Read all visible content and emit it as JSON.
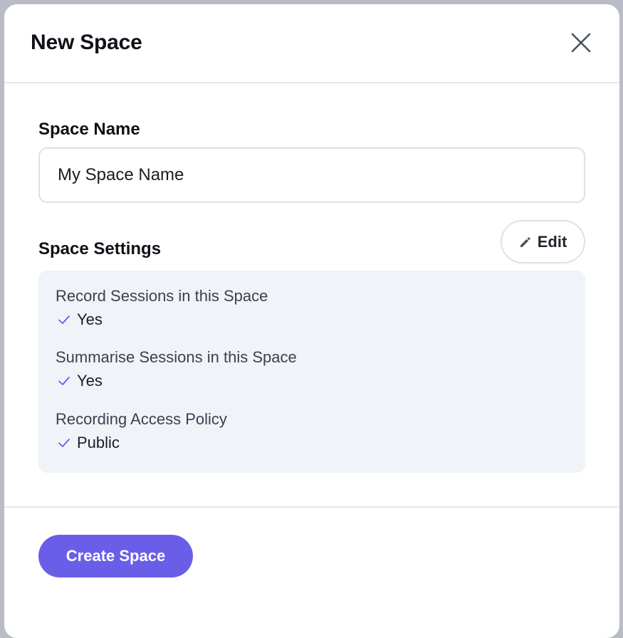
{
  "dialog": {
    "title": "New Space",
    "close_icon": "close-icon"
  },
  "space_name": {
    "label": "Space Name",
    "value": "My Space Name"
  },
  "space_settings": {
    "label": "Space Settings",
    "edit_label": "Edit",
    "edit_icon": "pencil-icon",
    "items": [
      {
        "title": "Record Sessions in this Space",
        "value": "Yes",
        "icon": "check-icon"
      },
      {
        "title": "Summarise Sessions in this Space",
        "value": "Yes",
        "icon": "check-icon"
      },
      {
        "title": "Recording Access Policy",
        "value": "Public",
        "icon": "check-icon"
      }
    ]
  },
  "footer": {
    "create_label": "Create Space"
  },
  "colors": {
    "accent": "#6a5ee8",
    "panel_background": "#f0f3f8",
    "border": "#dde1e8",
    "backdrop": "#b9bcc4"
  }
}
